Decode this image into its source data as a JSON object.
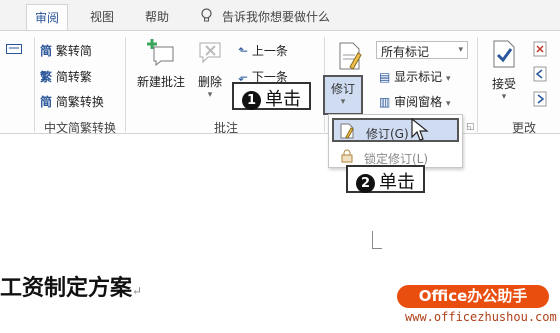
{
  "tabs": [
    {
      "label": "审阅",
      "active": true
    },
    {
      "label": "视图"
    },
    {
      "label": "帮助"
    }
  ],
  "tell_me": "告诉我你想要做什么",
  "chinese_conversion": {
    "items": [
      "繁转简",
      "简转繁",
      "简繁转换"
    ],
    "group_label": "中文简繁转换"
  },
  "comments": {
    "new_comment": "新建批注",
    "delete": "删除",
    "previous": "上一条",
    "next": "下一条",
    "group_label": "批注"
  },
  "tracking": {
    "track_changes": "修订",
    "markup_dropdown": "所有标记",
    "show_markup": "显示标记",
    "review_pane": "审阅窗格"
  },
  "changes": {
    "accept": "接受",
    "group_label": "更改"
  },
  "callouts": {
    "step1_num": "1",
    "step1_text": "单击",
    "step2_num": "2",
    "step2_text": "单击"
  },
  "dropdown_menu": {
    "item1": "修订(G)",
    "item2": "锁定修订(L)"
  },
  "document": {
    "title": "工资制定方案",
    "paragraph_mark": "↵"
  },
  "watermark": {
    "brand": "Office办公助手",
    "url": "www.officezhushou.com"
  },
  "colors": {
    "accent": "#2b579a",
    "selection": "#cfdcf2",
    "watermark": "#e94e0f"
  }
}
